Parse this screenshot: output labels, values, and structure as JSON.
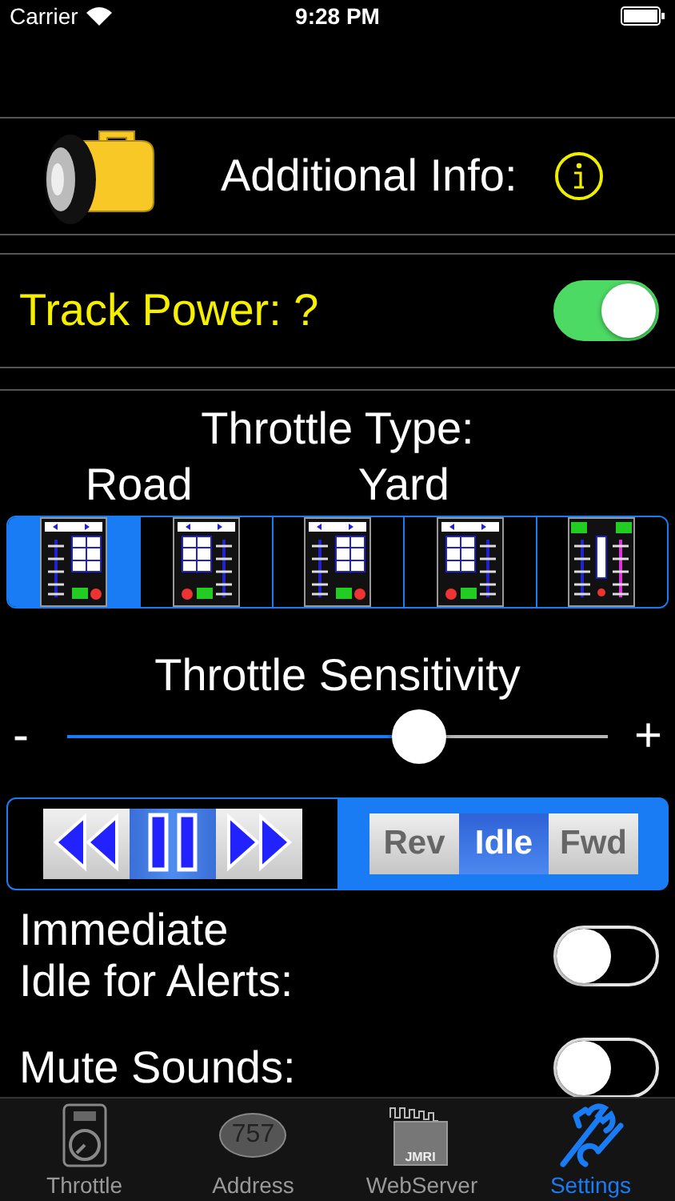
{
  "status_bar": {
    "carrier": "Carrier",
    "time": "9:28 PM"
  },
  "info": {
    "label": "Additional Info:"
  },
  "track_power": {
    "label": "Track Power: ?",
    "on": true
  },
  "throttle_type": {
    "title": "Throttle Type:",
    "groups": [
      "Road",
      "Yard"
    ],
    "options": [
      {
        "kind": "slider-left",
        "selected": true
      },
      {
        "kind": "slider-right",
        "selected": false
      },
      {
        "kind": "slider-left",
        "selected": false
      },
      {
        "kind": "slider-right",
        "selected": false
      },
      {
        "kind": "dual",
        "selected": false
      }
    ]
  },
  "sensitivity": {
    "title": "Throttle Sensitivity",
    "min_label": "-",
    "max_label": "+",
    "level": 0.65
  },
  "direction_buttons": [
    {
      "kind": "reverse",
      "selected": false
    },
    {
      "kind": "stop",
      "selected": true
    },
    {
      "kind": "forward",
      "selected": false
    }
  ],
  "direction_segments": [
    {
      "label": "Rev",
      "selected": false
    },
    {
      "label": "Idle",
      "selected": true
    },
    {
      "label": "Fwd",
      "selected": false
    }
  ],
  "options": [
    {
      "label": "Immediate\nIdle for Alerts:",
      "on": false
    },
    {
      "label": "Mute Sounds:",
      "on": false
    }
  ],
  "tabs": [
    {
      "kind": "throttle",
      "label": "Throttle",
      "selected": false
    },
    {
      "kind": "address",
      "label": "Address",
      "badge": "757",
      "selected": false
    },
    {
      "kind": "webserver",
      "label": "WebServer",
      "badge": "JMRI",
      "selected": false
    },
    {
      "kind": "settings",
      "label": "Settings",
      "selected": true
    }
  ]
}
